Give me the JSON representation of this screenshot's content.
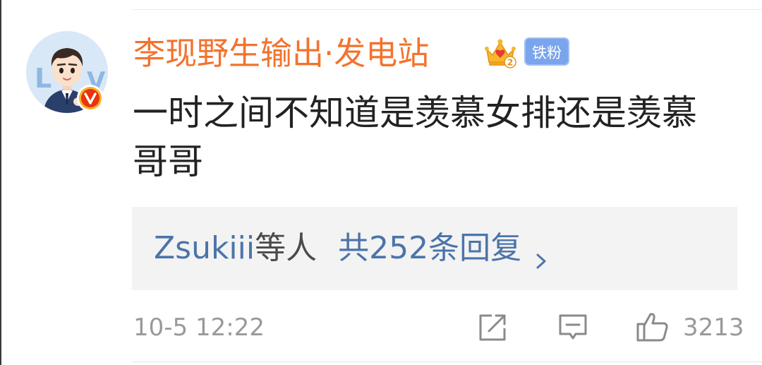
{
  "comment": {
    "username": "李现野生输出·发电站",
    "badges": {
      "crown_icon": "crown-level-2-icon",
      "fan_badge_label": "铁粉",
      "verified_icon": "verified-v-icon"
    },
    "text": "一时之间不知道是羡慕女排还是羡慕哥哥",
    "replies": {
      "users": "Zsukiii",
      "suffix": "等人",
      "count_text": "共252条回复"
    },
    "timestamp": "10-5 12:22",
    "actions": {
      "share_icon": "share-icon",
      "comment_icon": "comment-icon",
      "like_icon": "like-icon",
      "like_count": "3213"
    }
  },
  "colors": {
    "username": "#f3722e",
    "link": "#4c74aa",
    "text": "#222222",
    "meta": "#999999",
    "reply_bg": "#f3f3f3",
    "fan_badge": "#7aa5ec",
    "verified": "#e8340f",
    "crown": "#f5b82a"
  }
}
